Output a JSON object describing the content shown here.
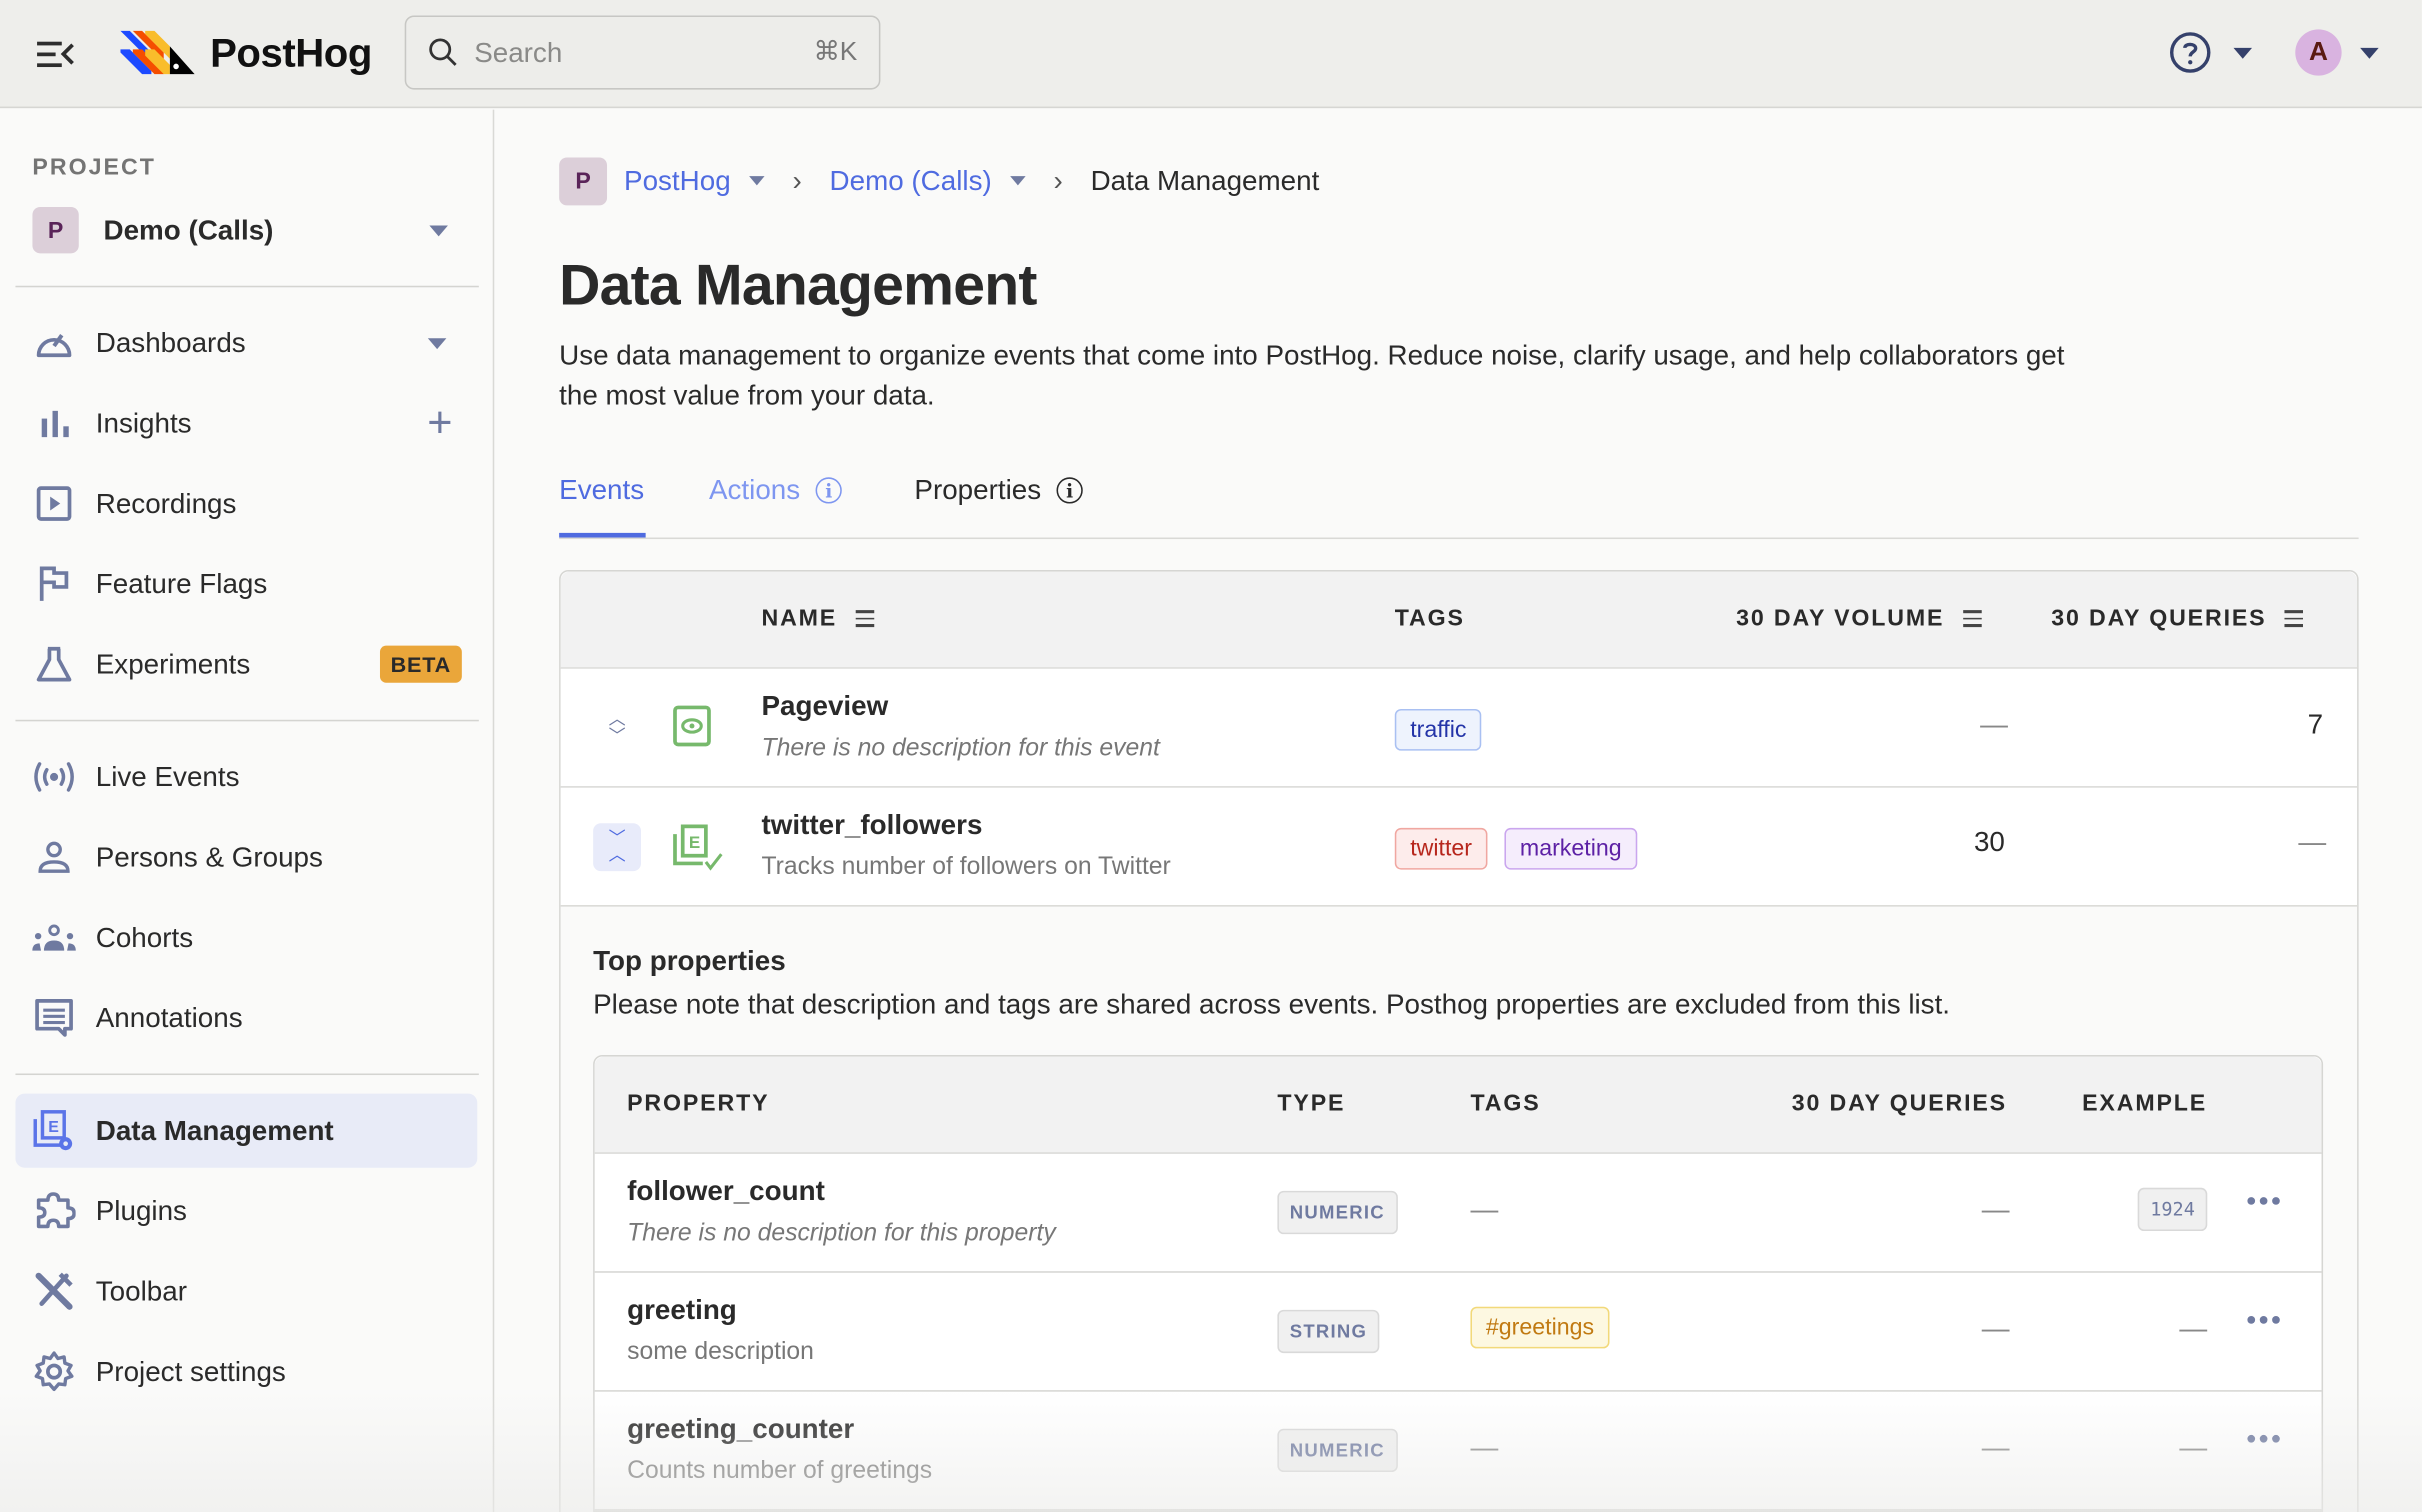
{
  "topbar": {
    "brand": "PostHog",
    "search_placeholder": "Search",
    "search_shortcut": "⌘K",
    "avatar_initial": "A"
  },
  "sidebar": {
    "project_label": "PROJECT",
    "project_badge": "P",
    "project_name": "Demo (Calls)",
    "groups": [
      [
        {
          "label": "Dashboards",
          "icon": "dashboard-icon",
          "trailing": "caret"
        },
        {
          "label": "Insights",
          "icon": "insights-icon",
          "trailing": "plus"
        },
        {
          "label": "Recordings",
          "icon": "recordings-icon"
        },
        {
          "label": "Feature Flags",
          "icon": "flag-icon"
        },
        {
          "label": "Experiments",
          "icon": "flask-icon",
          "badge": "BETA"
        }
      ],
      [
        {
          "label": "Live Events",
          "icon": "live-events-icon"
        },
        {
          "label": "Persons & Groups",
          "icon": "person-icon"
        },
        {
          "label": "Cohorts",
          "icon": "cohorts-icon"
        },
        {
          "label": "Annotations",
          "icon": "annotations-icon"
        }
      ],
      [
        {
          "label": "Data Management",
          "icon": "data-management-icon",
          "active": true
        },
        {
          "label": "Plugins",
          "icon": "puzzle-icon"
        },
        {
          "label": "Toolbar",
          "icon": "tools-icon"
        },
        {
          "label": "Project settings",
          "icon": "gear-icon"
        }
      ]
    ]
  },
  "breadcrumb": {
    "badge": "P",
    "items": [
      "PostHog",
      "Demo (Calls)"
    ],
    "current": "Data Management"
  },
  "page": {
    "title": "Data Management",
    "description": "Use data management to organize events that come into PostHog. Reduce noise, clarify usage, and help collaborators get the most value from your data."
  },
  "tabs": [
    {
      "label": "Events",
      "active": true
    },
    {
      "label": "Actions",
      "info": true
    },
    {
      "label": "Properties",
      "info": true
    }
  ],
  "events_table": {
    "columns": [
      "NAME",
      "TAGS",
      "30 DAY VOLUME",
      "30 DAY QUERIES"
    ],
    "rows": [
      {
        "name": "Pageview",
        "description": "There is no description for this event",
        "description_placeholder": true,
        "tags": [
          {
            "label": "traffic",
            "color": "blue"
          }
        ],
        "volume": "—",
        "queries": "7",
        "expanded": false
      },
      {
        "name": "twitter_followers",
        "description": "Tracks number of followers on Twitter",
        "description_placeholder": false,
        "tags": [
          {
            "label": "twitter",
            "color": "red"
          },
          {
            "label": "marketing",
            "color": "purple"
          }
        ],
        "volume": "30",
        "queries": "—",
        "expanded": true
      }
    ]
  },
  "top_properties": {
    "title": "Top properties",
    "note": "Please note that description and tags are shared across events. Posthog properties are excluded from this list.",
    "columns": [
      "PROPERTY",
      "TYPE",
      "TAGS",
      "30 DAY QUERIES",
      "EXAMPLE"
    ],
    "rows": [
      {
        "name": "follower_count",
        "description": "There is no description for this property",
        "description_placeholder": true,
        "type": "NUMERIC",
        "tags": [],
        "queries": "—",
        "example": "1924"
      },
      {
        "name": "greeting",
        "description": "some description",
        "description_placeholder": false,
        "type": "STRING",
        "tags": [
          {
            "label": "#greetings",
            "color": "yellow"
          }
        ],
        "queries": "—",
        "example": "—"
      },
      {
        "name": "greeting_counter",
        "description": "Counts number of greetings",
        "description_placeholder": false,
        "type": "NUMERIC",
        "tags": [],
        "queries": "—",
        "example": "—"
      }
    ]
  },
  "colors": {
    "accent": "#4f6be0",
    "icon_muted": "#6f7aa0",
    "event_icon": "#77b96c",
    "beta": "#eaa63a"
  }
}
